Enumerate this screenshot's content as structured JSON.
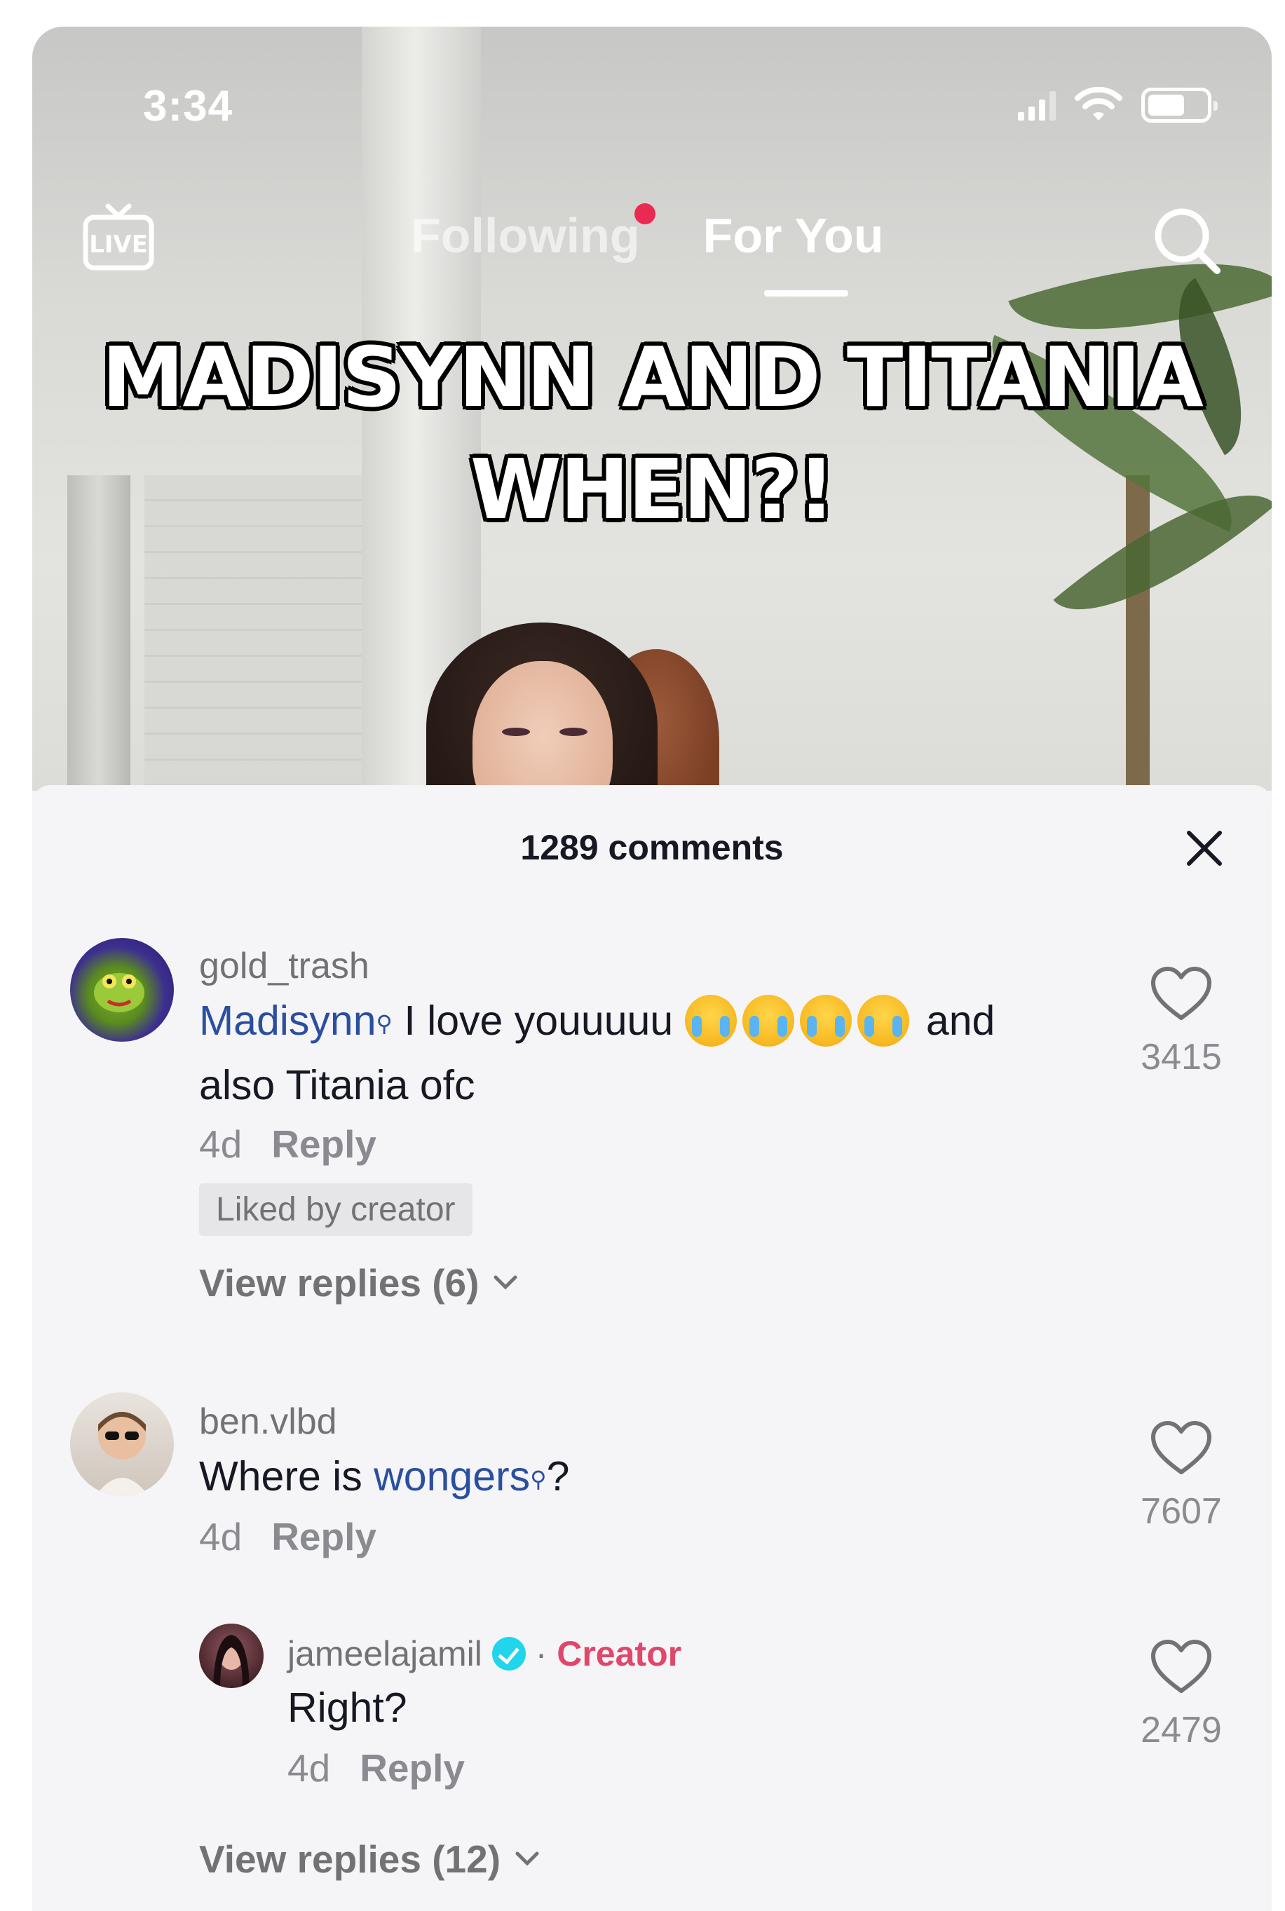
{
  "status_bar": {
    "time": "3:34"
  },
  "top_nav": {
    "live_label": "LIVE",
    "tabs": [
      {
        "label": "Following",
        "active": false,
        "has_notification_dot": true
      },
      {
        "label": "For You",
        "active": true
      }
    ]
  },
  "video": {
    "caption_line1": "MADISYNN AND TITANIA",
    "caption_line2": "WHEN?!"
  },
  "comments_sheet": {
    "title": "1289 comments",
    "comments": [
      {
        "username": "gold_trash",
        "mention": "Madisynn",
        "text_after_mention": " I love youuuuu ",
        "emoji_count": 4,
        "text_tail": " and",
        "text_line2": "also Titania ofc",
        "age": "4d",
        "reply_label": "Reply",
        "badge": "Liked by creator",
        "likes": "3415",
        "view_replies": "View replies (6)"
      },
      {
        "username": "ben.vlbd",
        "text_before_mention": "Where is ",
        "mention": "wongers",
        "text_after_mention": "?",
        "age": "4d",
        "reply_label": "Reply",
        "likes": "7607",
        "reply": {
          "username": "jameelajamil",
          "separator": " · ",
          "role": "Creator",
          "text": "Right?",
          "age": "4d",
          "reply_label": "Reply",
          "likes": "2479"
        },
        "view_replies": "View replies (12)"
      }
    ]
  },
  "colors": {
    "mention": "#2b4fa0",
    "creator": "#e0476b",
    "notification_dot": "#ea2a52",
    "verified": "#20d5ec"
  }
}
